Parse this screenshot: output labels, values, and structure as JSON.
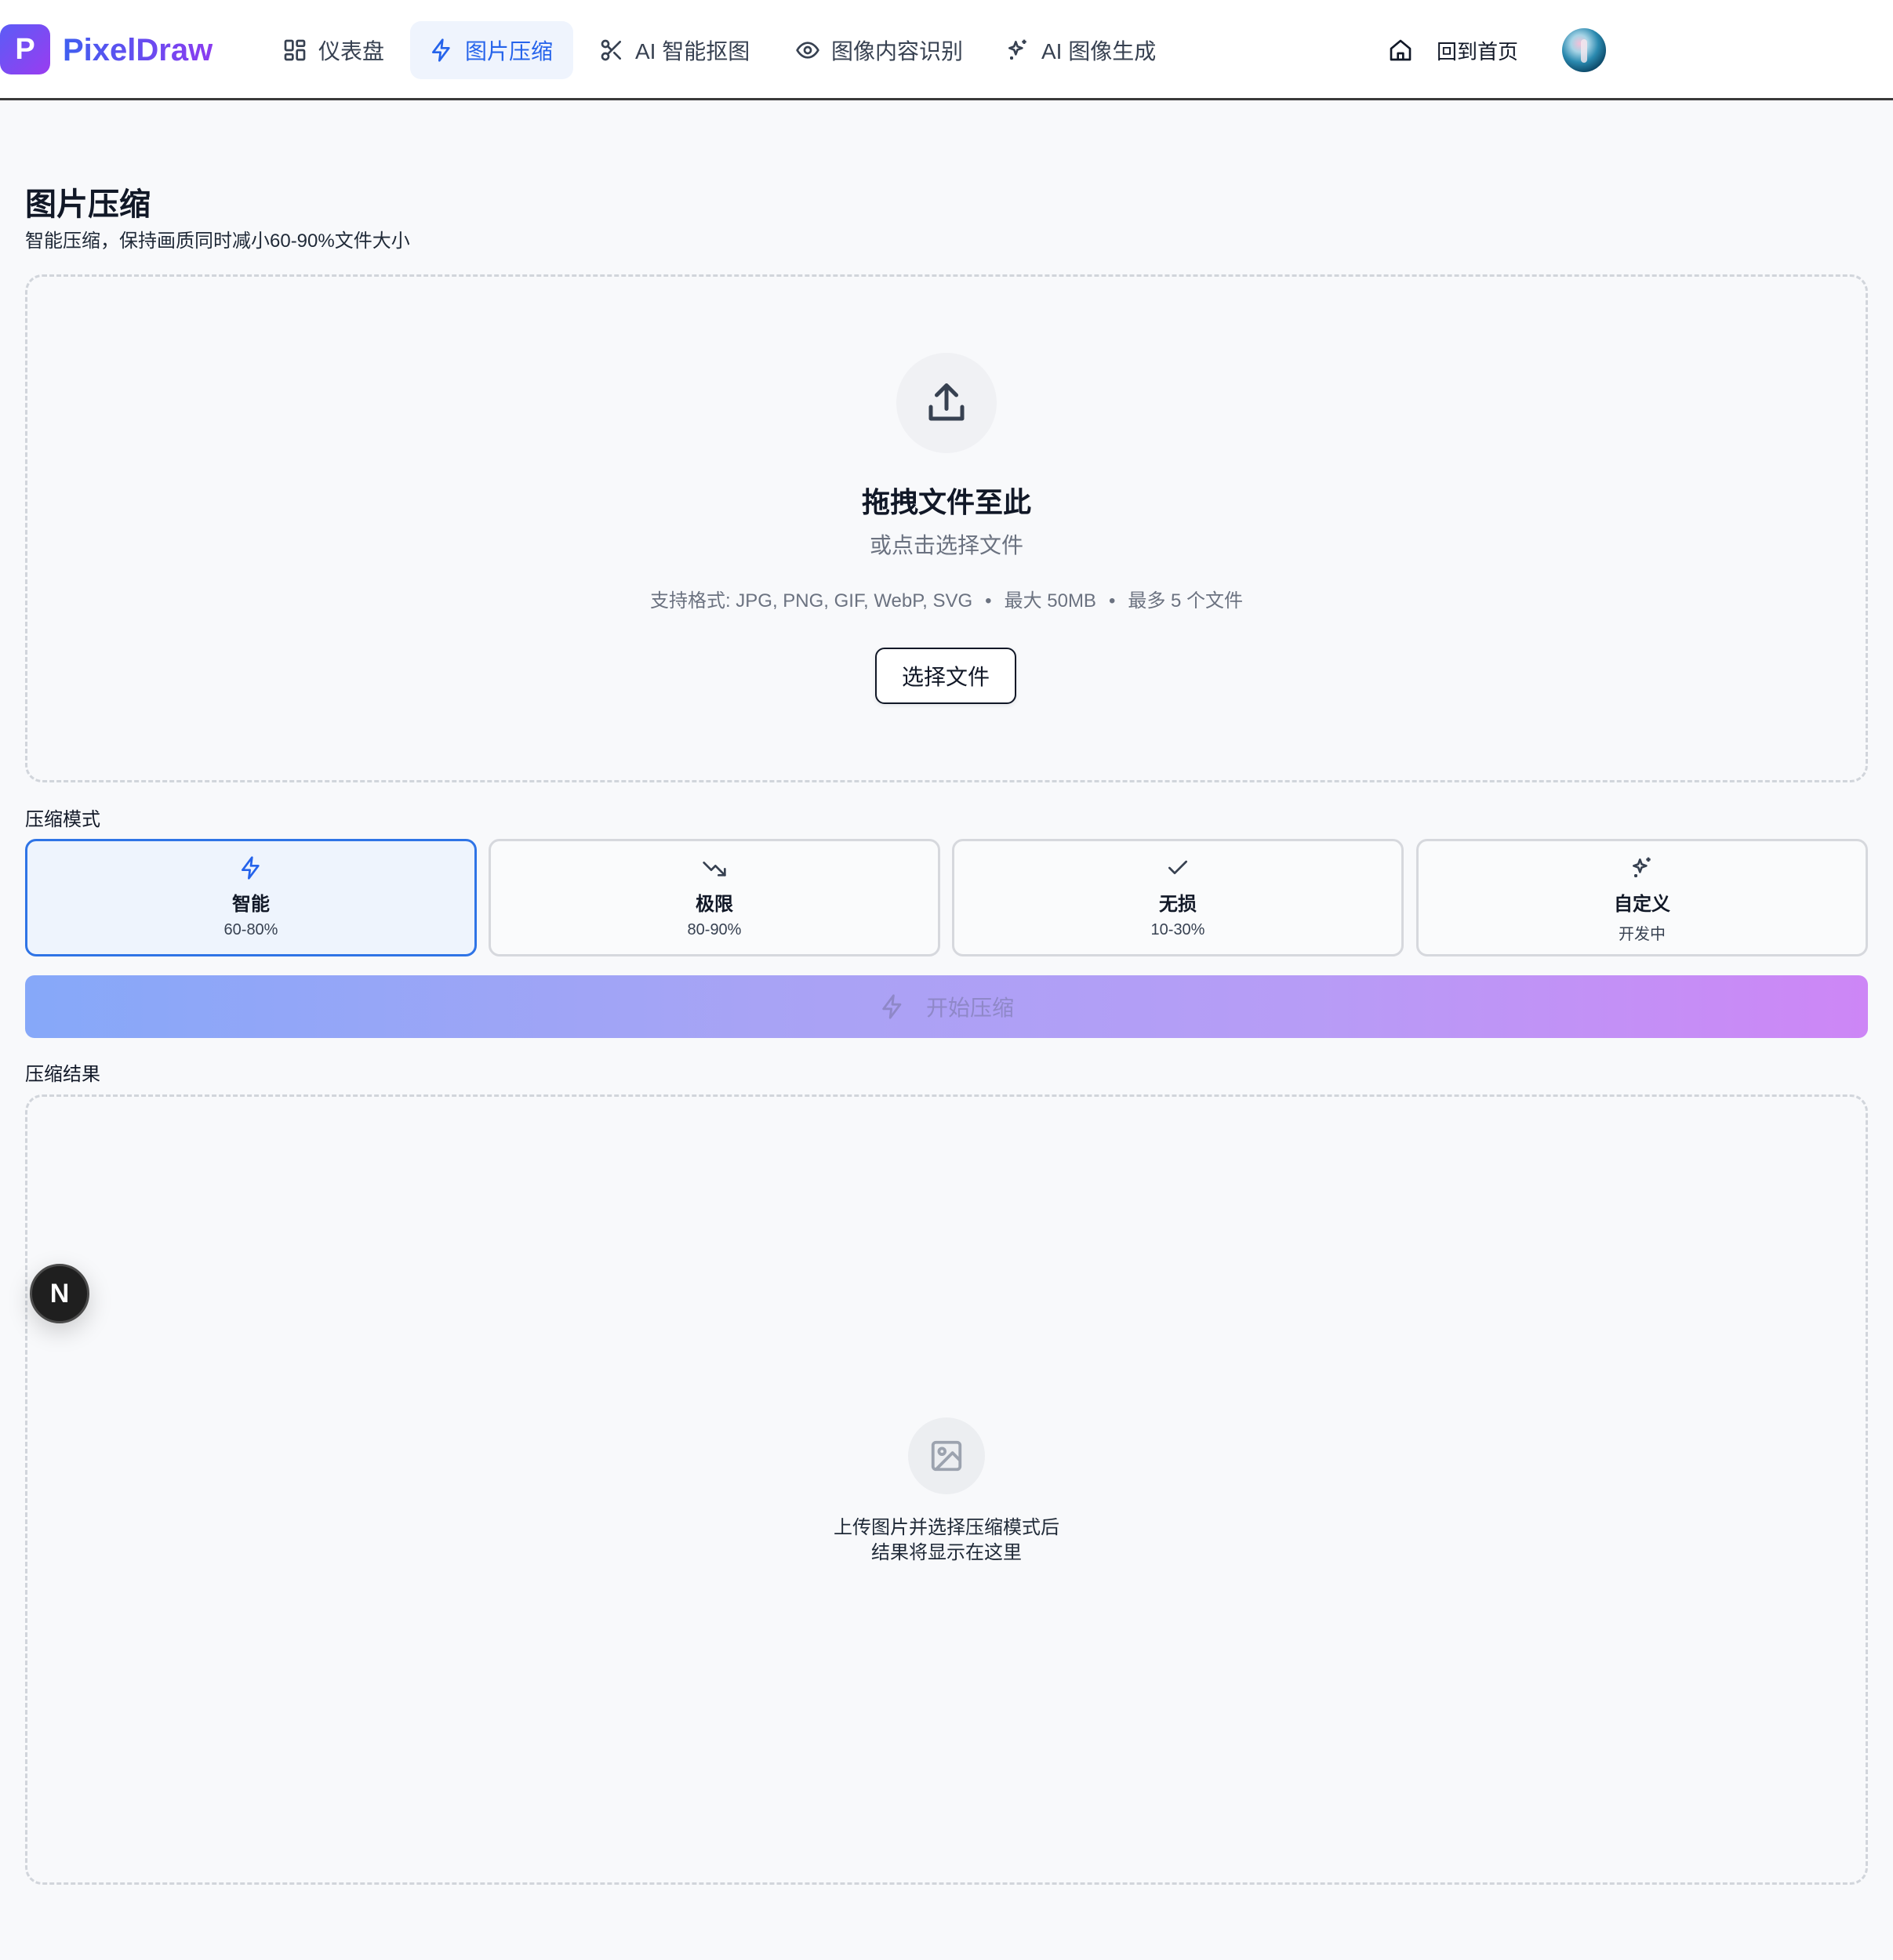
{
  "brand": {
    "badge": "P",
    "name": "PixelDraw"
  },
  "nav": {
    "items": [
      {
        "label": "仪表盘",
        "icon": "dashboard-grid-icon"
      },
      {
        "label": "图片压缩",
        "icon": "lightning-icon",
        "active": true
      },
      {
        "label": "AI 智能抠图",
        "icon": "scissors-icon"
      },
      {
        "label": "图像内容识别",
        "icon": "eye-icon"
      },
      {
        "label": "AI 图像生成",
        "icon": "sparkles-icon"
      }
    ],
    "home_label": "回到首页"
  },
  "page": {
    "title": "图片压缩",
    "subtitle": "智能压缩，保持画质同时减小60-90%文件大小"
  },
  "upload": {
    "title": "拖拽文件至此",
    "subtitle": "或点击选择文件",
    "formats": "支持格式: JPG, PNG, GIF, WebP, SVG",
    "max_size": "最大 50MB",
    "max_files": "最多 5 个文件",
    "separator": "•",
    "button": "选择文件"
  },
  "modes": {
    "label": "压缩模式",
    "items": [
      {
        "name": "智能",
        "range": "60-80%",
        "icon": "lightning-icon",
        "selected": true
      },
      {
        "name": "极限",
        "range": "80-90%",
        "icon": "trending-down-icon"
      },
      {
        "name": "无损",
        "range": "10-30%",
        "icon": "check-icon"
      },
      {
        "name": "自定义",
        "range": "开发中",
        "icon": "sparkles-icon"
      }
    ]
  },
  "start_button": "开始压缩",
  "results": {
    "label": "压缩结果",
    "empty_line1": "上传图片并选择压缩模式后",
    "empty_line2": "结果将显示在这里"
  },
  "floating_badge": "N",
  "colors": {
    "accent": "#2563eb",
    "active_border": "#2f74e6",
    "brand_gradient_start": "#5b5cf6",
    "brand_gradient_end": "#9a3cf0"
  }
}
